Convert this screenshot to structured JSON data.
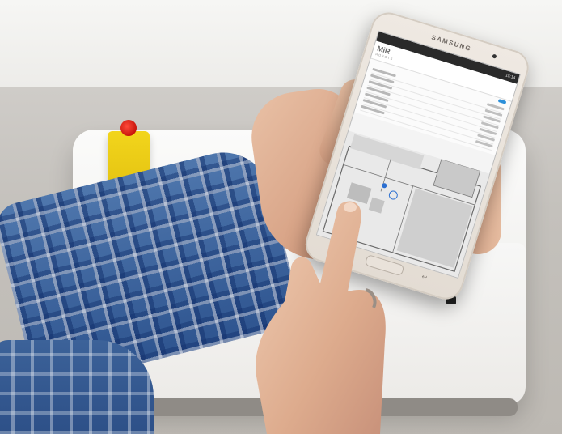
{
  "tablet": {
    "brand": "SAMSUNG",
    "status_time": "15:14",
    "screen": {
      "logo": "MiR",
      "logo_sub": "ROBOTS",
      "title": "",
      "subtitle": "",
      "download_button": "",
      "info_rows": 7,
      "map_robot_marker_color": "#2b6fd1"
    }
  },
  "colors": {
    "estop_red": "#d0190f",
    "estop_yellow": "#f0d11a",
    "sleeve_blue": "#3a609a",
    "robot_white": "#f4f3f1",
    "floor_grey": "#c4c1bc",
    "app_accent": "#2b8fd9"
  }
}
